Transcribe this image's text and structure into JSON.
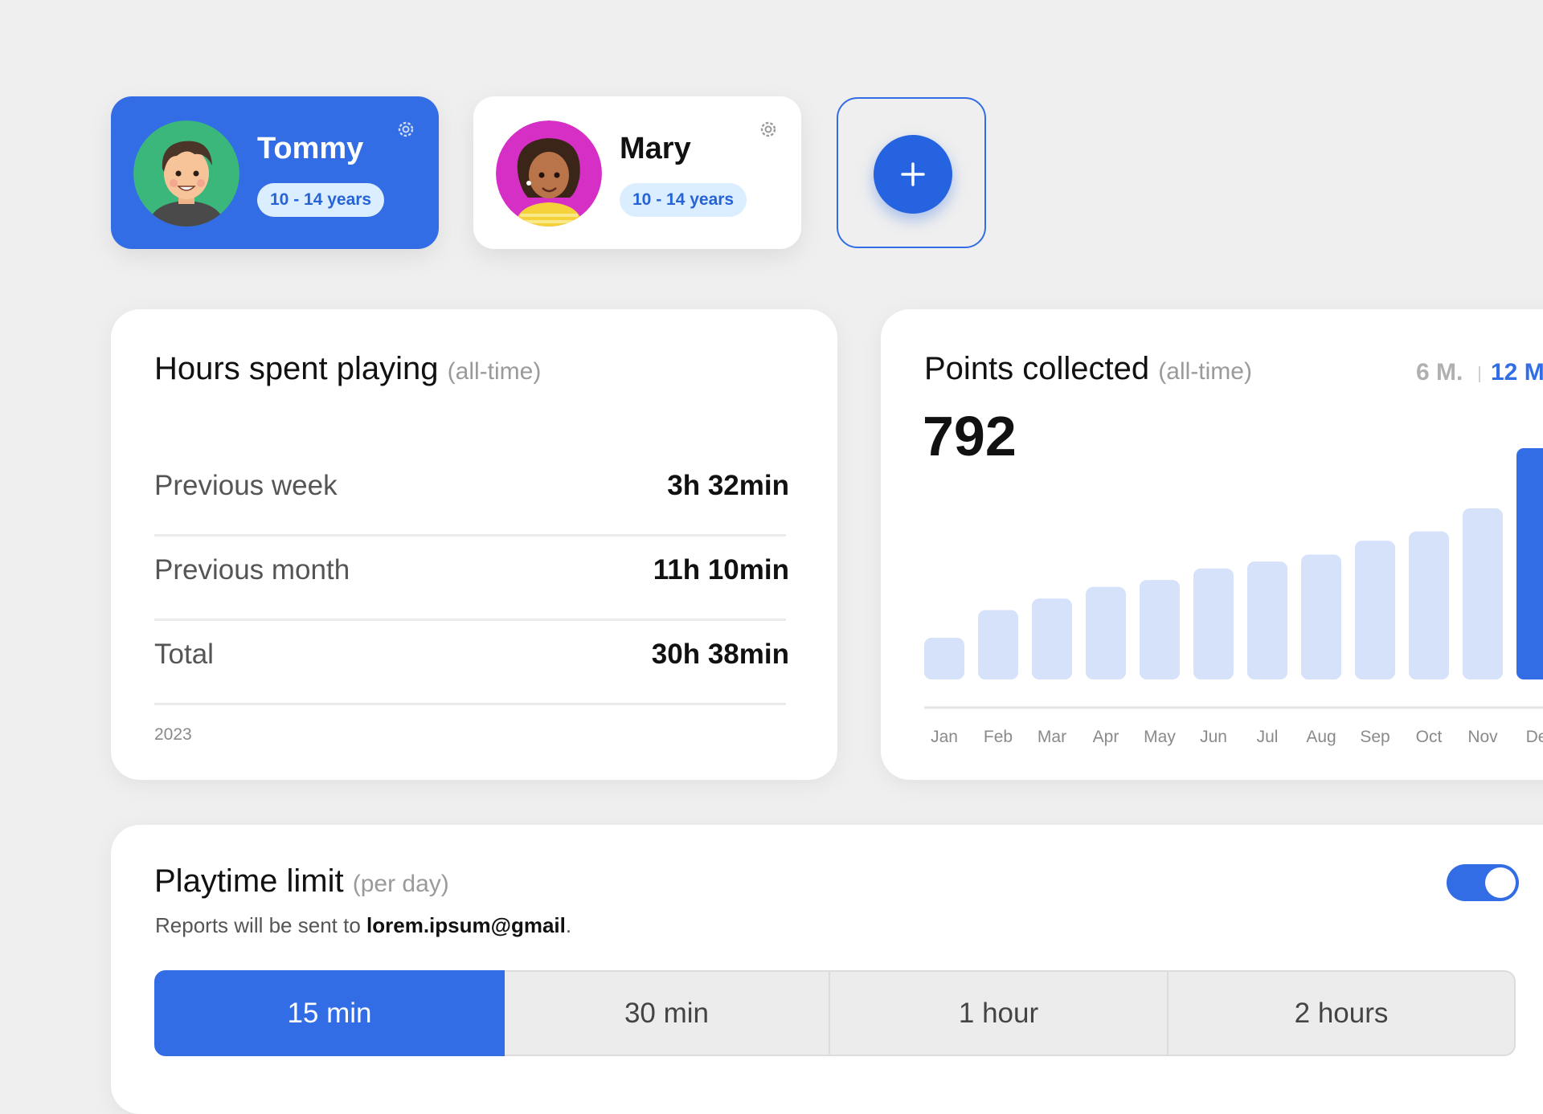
{
  "profiles": [
    {
      "name": "Tommy",
      "age": "10 - 14 years",
      "active": true
    },
    {
      "name": "Mary",
      "age": "10 - 14 years",
      "active": false
    }
  ],
  "hours": {
    "title": "Hours spent playing",
    "subtitle": "(all-time)",
    "rows": [
      {
        "label": "Previous week",
        "value": "3h 32min"
      },
      {
        "label": "Previous month",
        "value": "11h 10min"
      },
      {
        "label": "Total",
        "value": "30h 38min"
      }
    ],
    "year": "2023"
  },
  "points": {
    "title": "Points collected",
    "subtitle": "(all-time)",
    "total": "792",
    "range_options": [
      "6 M.",
      "12 M"
    ],
    "selected_range": "12 M"
  },
  "chart_data": {
    "type": "bar",
    "categories": [
      "Jan",
      "Feb",
      "Mar",
      "Apr",
      "May",
      "Jun",
      "Jul",
      "Aug",
      "Sep",
      "Oct",
      "Nov",
      "De"
    ],
    "values": [
      18,
      30,
      35,
      40,
      43,
      48,
      51,
      54,
      60,
      64,
      74,
      100
    ],
    "highlighted_index": 11,
    "colors": {
      "bar": "#d6e2fa",
      "highlight": "#336de5",
      "axis": "#e4e4e4",
      "label": "#8a8a8a"
    },
    "grid": false
  },
  "playtime": {
    "title": "Playtime limit",
    "subtitle": "(per day)",
    "report_prefix": "Reports will be sent to",
    "email": "lorem.ipsum@gmail",
    "report_suffix": ".",
    "enabled": true,
    "options": [
      "15 min",
      "30 min",
      "1 hour",
      "2 hours"
    ],
    "selected_option": "15 min"
  },
  "colors": {
    "accent": "#336de5",
    "badge_bg": "#dbeeff",
    "badge_text": "#2563d6"
  }
}
